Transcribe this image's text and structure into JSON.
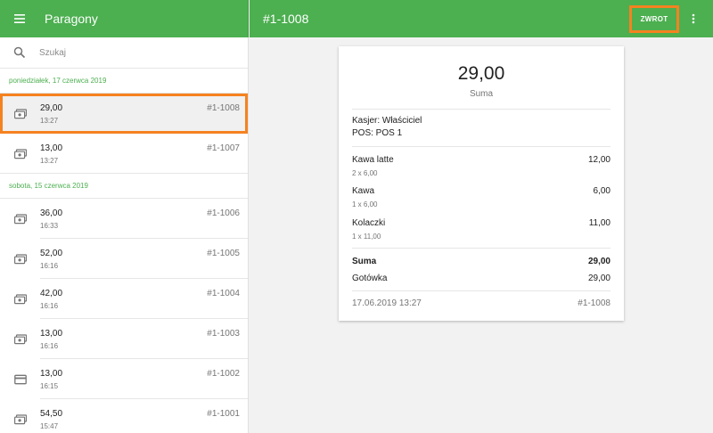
{
  "header": {
    "app_title": "Paragony",
    "receipt_title": "#1-1008",
    "refund_label": "ZWROT"
  },
  "search": {
    "placeholder": "Szukaj"
  },
  "receipt_groups": [
    {
      "date": "poniedziałek, 17 czerwca 2019",
      "receipts": [
        {
          "amount": "29,00",
          "time": "13:27",
          "number": "#1-1008",
          "payment": "cash",
          "selected": true
        },
        {
          "amount": "13,00",
          "time": "13:27",
          "number": "#1-1007",
          "payment": "cash"
        }
      ]
    },
    {
      "date": "sobota, 15 czerwca 2019",
      "receipts": [
        {
          "amount": "36,00",
          "time": "16:33",
          "number": "#1-1006",
          "payment": "cash"
        },
        {
          "amount": "52,00",
          "time": "16:16",
          "number": "#1-1005",
          "payment": "cash"
        },
        {
          "amount": "42,00",
          "time": "16:16",
          "number": "#1-1004",
          "payment": "cash"
        },
        {
          "amount": "13,00",
          "time": "16:16",
          "number": "#1-1003",
          "payment": "cash"
        },
        {
          "amount": "13,00",
          "time": "16:15",
          "number": "#1-1002",
          "payment": "card"
        },
        {
          "amount": "54,50",
          "time": "15:47",
          "number": "#1-1001",
          "payment": "cash"
        }
      ]
    }
  ],
  "receipt": {
    "total": "29,00",
    "total_label": "Suma",
    "cashier": "Kasjer: Właściciel",
    "pos": "POS: POS 1",
    "items": [
      {
        "name": "Kawa latte",
        "qty": "2 x 6,00",
        "price": "12,00"
      },
      {
        "name": "Kawa",
        "qty": "1 x 6,00",
        "price": "6,00"
      },
      {
        "name": "Kolaczki",
        "qty": "1 x 11,00",
        "price": "11,00"
      }
    ],
    "sum_label": "Suma",
    "sum_value": "29,00",
    "payment_label": "Gotówka",
    "payment_value": "29,00",
    "datetime": "17.06.2019 13:27",
    "number": "#1-1008"
  },
  "colors": {
    "primary": "#4caf50",
    "highlight": "#f58220"
  },
  "icons": {
    "menu": "menu-icon",
    "search": "search-icon",
    "more": "more-vert-icon",
    "cash": "cash-icon",
    "card": "credit-card-icon"
  }
}
